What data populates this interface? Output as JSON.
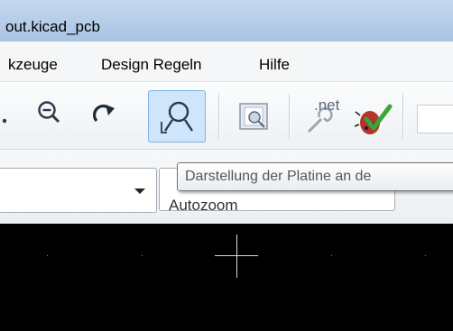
{
  "window": {
    "title": "out.kicad_pcb"
  },
  "menubar": {
    "items": [
      {
        "label": "kzeuge"
      },
      {
        "label": "Design Regeln"
      },
      {
        "label": "Hilfe"
      }
    ]
  },
  "toolbar": {
    "icons": [
      "ellipsis-icon",
      "zoom-out-icon",
      "redraw-icon",
      "zoom-fit-icon",
      "board-view-icon",
      "netlist-icon",
      "drc-icon"
    ],
    "netlist_label": ".net"
  },
  "toolbar2": {
    "layer_select": {
      "value": ""
    },
    "zoom_select": {
      "value": "Autozoom"
    }
  },
  "tooltip": {
    "text": "Darstellung der Platine an de"
  },
  "colors": {
    "canvas": "#000000",
    "accent_highlight": "#c8e0f8"
  }
}
